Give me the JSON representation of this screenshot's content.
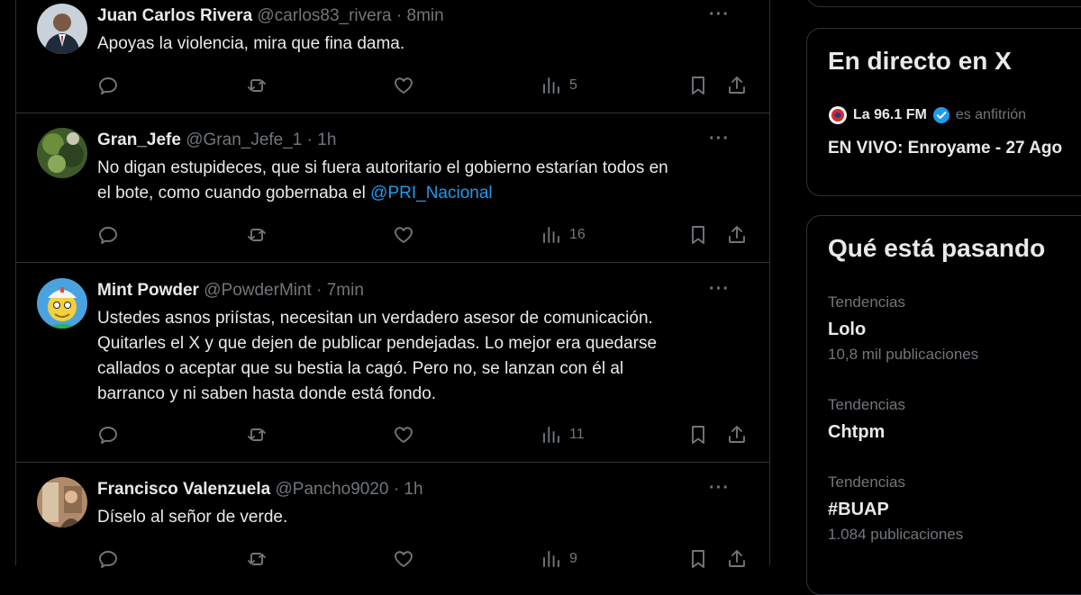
{
  "colors": {
    "background": "#000000",
    "text": "#e7e9ea",
    "muted": "#71767b",
    "border": "#2f3336",
    "link": "#1d9bf0",
    "verified": "#1d9bf0"
  },
  "tweets": [
    {
      "name": "Juan Carlos Rivera",
      "handle": "@carlos83_rivera",
      "time": "8min",
      "lines": [
        "Apoyas la violencia, mira que fina dama."
      ],
      "views": "5"
    },
    {
      "name": "Gran_Jefe",
      "handle": "@Gran_Jefe_1",
      "time": "1h",
      "lines": [
        "No digan estupideces, que si fuera autoritario el gobierno estarían todos en",
        "el bote, como cuando gobernaba el "
      ],
      "mention": "@PRI_Nacional",
      "views": "16"
    },
    {
      "name": "Mint Powder",
      "handle": "@PowderMint",
      "time": "7min",
      "lines": [
        "Ustedes asnos priístas, necesitan un verdadero asesor de comunicación.",
        "Quitarles el X y que dejen de publicar pendejadas. Lo mejor era quedarse",
        "callados o aceptar que su bestia la cagó. Pero no, se lanzan con él al",
        "barranco y ni saben hasta donde está fondo."
      ],
      "views": "11"
    },
    {
      "name": "Francisco Valenzuela",
      "handle": "@Pancho9020",
      "time": "1h",
      "lines": [
        "Díselo al señor de verde."
      ],
      "views": "9"
    }
  ],
  "sidebar": {
    "live": {
      "title": "En directo en X",
      "host_name": "La 96.1 FM",
      "host_role": "es anfitrión",
      "event": "EN VIVO: Enroyame - 27 Ago"
    },
    "trends": {
      "title": "Qué está pasando",
      "items": [
        {
          "label": "Tendencias",
          "name": "Lolo",
          "posts": "10,8 mil publicaciones"
        },
        {
          "label": "Tendencias",
          "name": "Chtpm",
          "posts": ""
        },
        {
          "label": "Tendencias",
          "name": "#BUAP",
          "posts": "1.084 publicaciones"
        }
      ]
    }
  }
}
